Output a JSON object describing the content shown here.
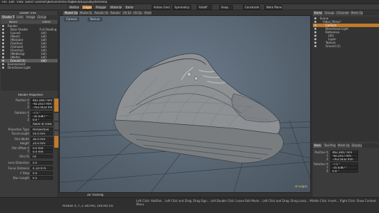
{
  "menu": [
    "File",
    "Edit",
    "View",
    "Select",
    "Geometry",
    "Texture",
    "Vertex Map",
    "Render",
    "Layout",
    "System",
    "Help"
  ],
  "toolbar": {
    "mode_buttons": [
      "Vertices",
      "Edges",
      "Polygons",
      "Materials",
      "Items"
    ],
    "action_center": "Action Center",
    "symmetry": "Symmetry: Off",
    "falloff": "Falloff",
    "snap": "Snap",
    "constraint": "Constraint",
    "workplane": "Work Plane"
  },
  "left_top": {
    "title": "Shader Tree",
    "tabs": [
      "Shader Tree",
      "Lists",
      "Images",
      "Groups"
    ],
    "columns": [
      "Name",
      "Effect"
    ],
    "items": [
      {
        "name": "Render",
        "effect": ""
      },
      {
        "name": "Base Shader",
        "effect": "Full Shading"
      },
      {
        "name": "(Laces)",
        "effect": "(all)"
      },
      {
        "name": "(Mesh)",
        "effect": "(all)"
      },
      {
        "name": "(Midsole)",
        "effect": "(all)"
      },
      {
        "name": "(Outline)",
        "effect": "(all)"
      },
      {
        "name": "(Outsole)",
        "effect": "(all)"
      },
      {
        "name": "(Overlay)",
        "effect": "(all)"
      },
      {
        "name": "(Webbing)",
        "effect": "(all)"
      },
      {
        "name": "(Welts)",
        "effect": "(all)"
      },
      {
        "name": "Ground (1)",
        "effect": "(all)"
      },
      {
        "name": "Environment",
        "effect": ""
      },
      {
        "name": "Directional Light",
        "effect": ""
      }
    ]
  },
  "properties": {
    "title": "Render Properties",
    "fields": [
      {
        "label": "Position X",
        "value": "462.3047 mm"
      },
      {
        "label": "Y",
        "value": "-92.2417 mm"
      },
      {
        "label": "Z",
        "value": "-763.5432 mm"
      },
      {
        "label": "Rotation X",
        "value": "-7.5 °"
      },
      {
        "label": "Y",
        "value": "-35.4387 °"
      },
      {
        "label": "Z",
        "value": "0.0 °"
      },
      {
        "label": "",
        "value": "Apply to View"
      },
      {
        "label": "Projection Type",
        "value": "Perspective"
      },
      {
        "label": "Focal Length",
        "value": "50.0 mm"
      },
      {
        "label": "Film Width",
        "value": "36.0 mm"
      },
      {
        "label": "Height",
        "value": "24.0 mm"
      },
      {
        "label": "Film Offset X",
        "value": "0.0 mm"
      },
      {
        "label": "Y",
        "value": "0.0 mm"
      },
      {
        "label": "Film Fit",
        "value": "Fill"
      },
      {
        "label": "Lens Distortion",
        "value": "0.0"
      },
      {
        "label": "Focus Distance",
        "value": "4.1474 m"
      },
      {
        "label": "F-Stop",
        "value": "4.0"
      },
      {
        "label": "Blur Length",
        "value": "0.5"
      }
    ]
  },
  "viewport": {
    "tabs": [
      "Model Single",
      "Model Quad",
      "Render Single",
      "Render Fit",
      "UV Edit",
      "UV Quad",
      "Paint"
    ],
    "camera_label": "Camera",
    "texture_label": "Texture",
    "stats": "30 Edges",
    "footer_label": "3D Tracking"
  },
  "status": {
    "left": "Position X, Y, Z   100 Pos, 100 Pos 4.6",
    "right": "Left Click: Add/Sel... Left Click and Drag: Drag Sign... Left Double Click: Leave Edit Mode... Left Click and Drag: Drag Lasso... Middle Click: Invert... Right Click: Show Context Menu"
  },
  "right_top": {
    "tabs": [
      "Items",
      "Groups",
      "Channels",
      "Mesh Ops"
    ],
    "items": [
      {
        "name": "Scene",
        "indent": 0
      },
      {
        "name": "Video_Rhino*",
        "indent": 1
      },
      {
        "name": "Camera",
        "indent": 2
      },
      {
        "name": "Directional Light",
        "indent": 2
      },
      {
        "name": "Reference",
        "indent": 2
      },
      {
        "name": "(All)",
        "indent": 3
      },
      {
        "name": "Layer",
        "indent": 3
      },
      {
        "name": "Texture",
        "indent": 2
      },
      {
        "name": "Ground (1)",
        "indent": 2
      }
    ]
  },
  "right_bottom": {
    "tabs": [
      "Item",
      "Tool Prop",
      "Mesh Ops",
      "Display"
    ],
    "fields": [
      {
        "label": "Position X",
        "value": "462.3047 mm"
      },
      {
        "label": "Y",
        "value": "-92.2417 mm"
      },
      {
        "label": "Z",
        "value": "-763.5432 mm"
      },
      {
        "label": "Rotation X",
        "value": "-7.5 °"
      },
      {
        "label": "Y",
        "value": "-35.4387 °"
      },
      {
        "label": "Z",
        "value": "0.0 °"
      }
    ]
  },
  "colors": {
    "accent": "#c07a2a",
    "viewport_bg": "#5d6b7c",
    "panel": "#3a3a3a"
  }
}
